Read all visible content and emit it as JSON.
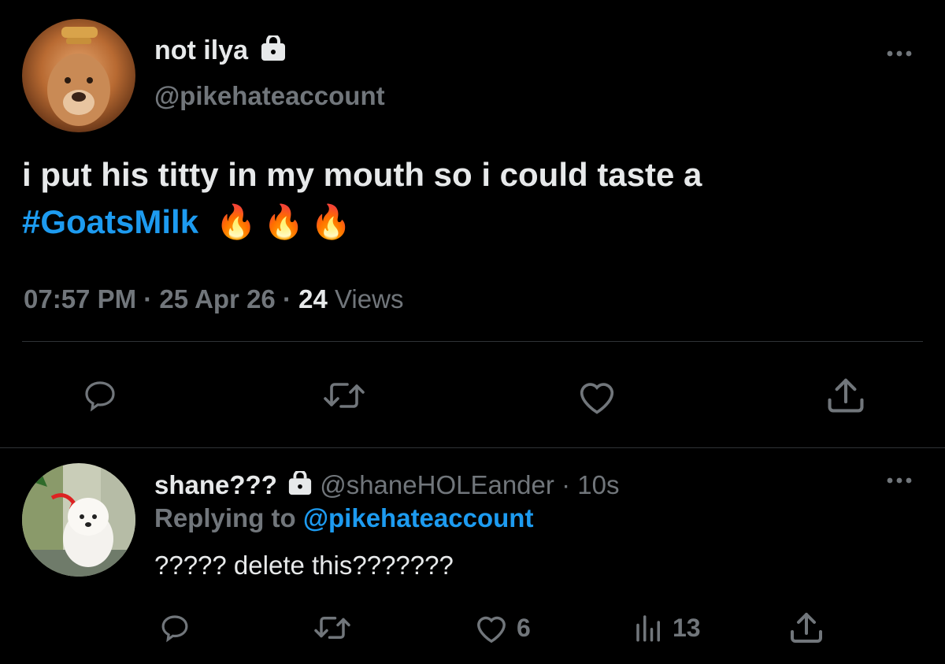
{
  "main_tweet": {
    "display_name": "not ilya",
    "handle": "@pikehateaccount",
    "text_line1": "i put his titty in my mouth so i could taste a",
    "hashtag": "#GoatsMilk",
    "emojis": "🔥🔥🔥",
    "time": "07:57 PM",
    "date": "25 Apr 26",
    "views_count": "24",
    "views_label": "Views",
    "sep": "·"
  },
  "reply_tweet": {
    "display_name": "shane???",
    "handle": "@shaneHOLEander",
    "age": "10s",
    "sep": "·",
    "replying_prefix": "Replying to",
    "replying_handle": "@pikehateaccount",
    "text": "????? delete this???????",
    "like_count": "6",
    "views_count": "13"
  },
  "icons": {
    "more": "more-icon",
    "reply": "reply-icon",
    "retweet": "retweet-icon",
    "like": "heart-icon",
    "share": "share-icon",
    "views": "analytics-icon",
    "lock": "lock-icon"
  },
  "colors": {
    "background": "#000000",
    "text": "#e7e9ea",
    "muted": "#71767b",
    "link": "#1d9bf0",
    "divider": "#2f3336"
  }
}
